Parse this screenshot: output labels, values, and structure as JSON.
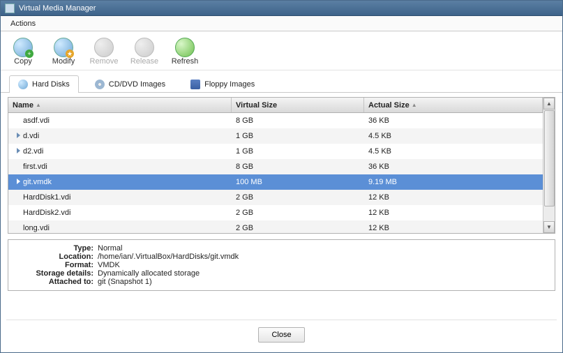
{
  "window": {
    "title": "Virtual Media Manager"
  },
  "menu": {
    "actions": "Actions"
  },
  "toolbar": {
    "copy": "Copy",
    "modify": "Modify",
    "remove": "Remove",
    "release": "Release",
    "refresh": "Refresh"
  },
  "tabs": {
    "hard_disks": "Hard Disks",
    "cd_dvd": "CD/DVD Images",
    "floppy": "Floppy Images"
  },
  "columns": {
    "name": "Name",
    "virtual": "Virtual Size",
    "actual": "Actual Size"
  },
  "rows": [
    {
      "name": "asdf.vdi",
      "virtual": "8 GB",
      "actual": "36 KB",
      "expandable": false
    },
    {
      "name": "d.vdi",
      "virtual": "1 GB",
      "actual": "4.5 KB",
      "expandable": true
    },
    {
      "name": "d2.vdi",
      "virtual": "1 GB",
      "actual": "4.5 KB",
      "expandable": true
    },
    {
      "name": "first.vdi",
      "virtual": "8 GB",
      "actual": "36 KB",
      "expandable": false
    },
    {
      "name": "git.vmdk",
      "virtual": "100 MB",
      "actual": "9.19 MB",
      "expandable": true,
      "selected": true
    },
    {
      "name": "HardDisk1.vdi",
      "virtual": "2 GB",
      "actual": "12 KB",
      "expandable": false
    },
    {
      "name": "HardDisk2.vdi",
      "virtual": "2 GB",
      "actual": "12 KB",
      "expandable": false
    },
    {
      "name": "long.vdi",
      "virtual": "2 GB",
      "actual": "12 KB",
      "expandable": false
    }
  ],
  "details": {
    "labels": {
      "type": "Type:",
      "location": "Location:",
      "format": "Format:",
      "storage": "Storage details:",
      "attached": "Attached to:"
    },
    "type": "Normal",
    "location": "/home/ian/.VirtualBox/HardDisks/git.vmdk",
    "format": "VMDK",
    "storage": "Dynamically allocated storage",
    "attached": "git (Snapshot 1)"
  },
  "footer": {
    "close": "Close"
  }
}
